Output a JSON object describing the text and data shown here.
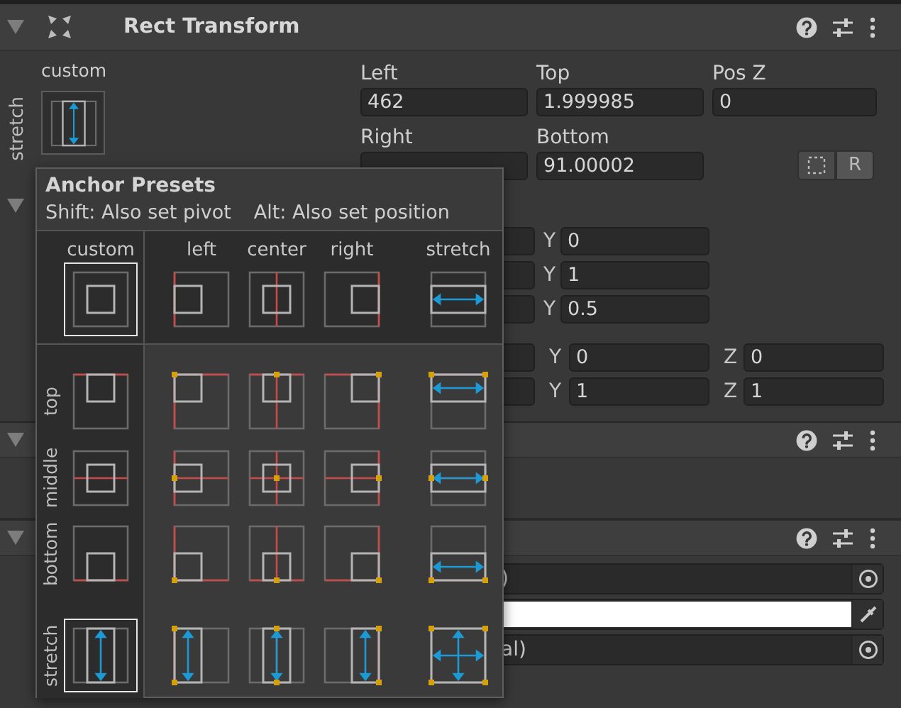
{
  "rect_transform": {
    "title": "Rect Transform",
    "expanded": true,
    "anchor_widget": {
      "horizontal_label": "custom",
      "vertical_label": "stretch"
    },
    "position_fields": [
      {
        "label": "Left",
        "value": "462"
      },
      {
        "label": "Top",
        "value": "1.999985"
      },
      {
        "label": "Pos Z",
        "value": "0"
      },
      {
        "label": "Right"
      },
      {
        "label": "Bottom",
        "value": "91.00002"
      }
    ],
    "raw_edit_button": {
      "label": "R"
    },
    "anchors_foldout": {
      "expanded": true,
      "rows": [
        {
          "axis": "Y",
          "value": "0"
        },
        {
          "axis": "Y",
          "value": "1"
        },
        {
          "axis": "Y",
          "value": "0.5"
        }
      ]
    },
    "vector_rows": [
      {
        "fields": [
          {
            "axis": "Y",
            "value": "0"
          },
          {
            "axis": "Z",
            "value": "0"
          }
        ]
      },
      {
        "fields": [
          {
            "axis": "Y",
            "value": "1"
          },
          {
            "axis": "Z",
            "value": "1"
          }
        ]
      }
    ]
  },
  "components": [
    {
      "expanded": true
    },
    {
      "expanded": true,
      "fields": [
        {
          "kind": "object",
          "value": ")"
        },
        {
          "kind": "color",
          "color": "#ffffff"
        },
        {
          "kind": "object",
          "value": "al)"
        }
      ]
    }
  ],
  "anchor_presets": {
    "title": "Anchor Presets",
    "hint_pivot": "Shift: Also set pivot",
    "hint_position": "Alt: Also set position",
    "columns": [
      "custom",
      "left",
      "center",
      "right",
      "stretch"
    ],
    "rows": [
      {
        "cells": [
          {
            "selected": true
          },
          {
            "selected": false
          },
          {
            "selected": false
          },
          {
            "selected": false
          },
          {
            "selected": false
          }
        ]
      },
      {
        "label": "top",
        "cells": [
          {
            "selected": false
          },
          {
            "selected": false
          },
          {
            "selected": false
          },
          {
            "selected": false
          },
          {
            "selected": false
          }
        ]
      },
      {
        "label": "middle",
        "cells": [
          {
            "selected": false
          },
          {
            "selected": false
          },
          {
            "selected": false
          },
          {
            "selected": false
          },
          {
            "selected": false
          }
        ]
      },
      {
        "label": "bottom",
        "cells": [
          {
            "selected": false
          },
          {
            "selected": false
          },
          {
            "selected": false
          },
          {
            "selected": false
          },
          {
            "selected": false
          }
        ]
      },
      {
        "label": "stretch",
        "cells": [
          {
            "selected": true
          },
          {
            "selected": false
          },
          {
            "selected": false
          },
          {
            "selected": false
          },
          {
            "selected": false
          }
        ]
      }
    ]
  }
}
